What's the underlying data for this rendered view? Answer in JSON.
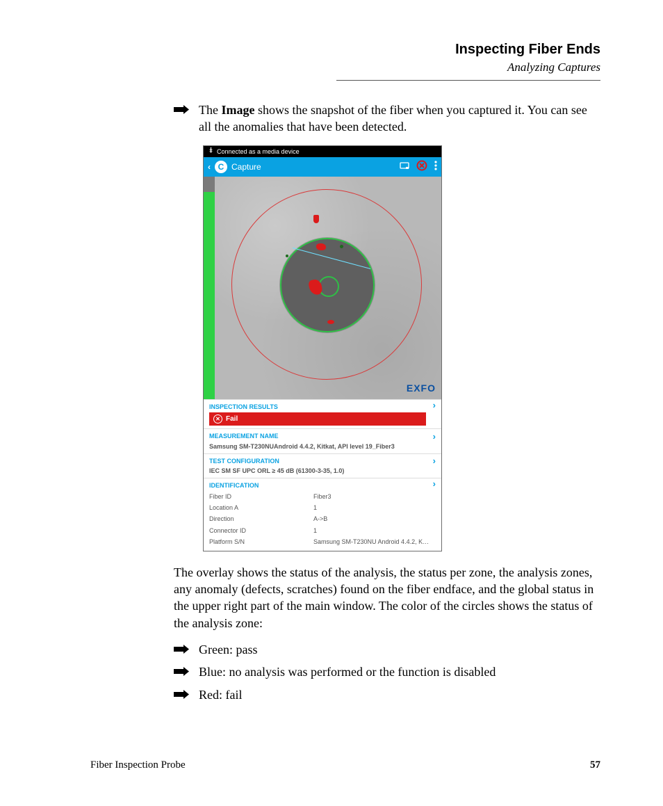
{
  "header": {
    "title": "Inspecting Fiber Ends",
    "subtitle": "Analyzing Captures"
  },
  "body": {
    "bullet1_pre": "The ",
    "bullet1_bold": "Image",
    "bullet1_post": " shows the snapshot of the fiber when you captured it. You can see all the anomalies that have been detected.",
    "paragraph": "The overlay shows the status of the analysis, the status per zone, the analysis zones, any anomaly (defects, scratches) found on the fiber endface, and the global status in the upper right part of the main window. The color of the circles shows the status of the analysis zone:",
    "status_bullets": [
      "Green: pass",
      "Blue: no analysis was performed or the function is disabled",
      "Red: fail"
    ]
  },
  "screenshot": {
    "notif_text": "Connected as a media device",
    "appbar": {
      "title": "Capture"
    },
    "brand": "EXFO",
    "sections": {
      "inspection_label": "INSPECTION RESULTS",
      "fail_text": "Fail",
      "measurement_label": "MEASUREMENT NAME",
      "measurement_value": "Samsung SM-T230NUAndroid 4.4.2, Kitkat, API level 19_Fiber3",
      "testconfig_label": "TEST CONFIGURATION",
      "testconfig_value": "IEC SM SF UPC ORL ≥ 45 dB (61300-3-35, 1.0)",
      "identification_label": "IDENTIFICATION",
      "identification_rows": [
        {
          "k": "Fiber ID",
          "v": "Fiber3"
        },
        {
          "k": "Location A",
          "v": "1"
        },
        {
          "k": "Direction",
          "v": "A->B"
        },
        {
          "k": "Connector ID",
          "v": "1"
        },
        {
          "k": "Platform S/N",
          "v": "Samsung SM-T230NU Android 4.4.2, K…"
        }
      ]
    }
  },
  "footer": {
    "left": "Fiber Inspection Probe",
    "page": "57"
  }
}
